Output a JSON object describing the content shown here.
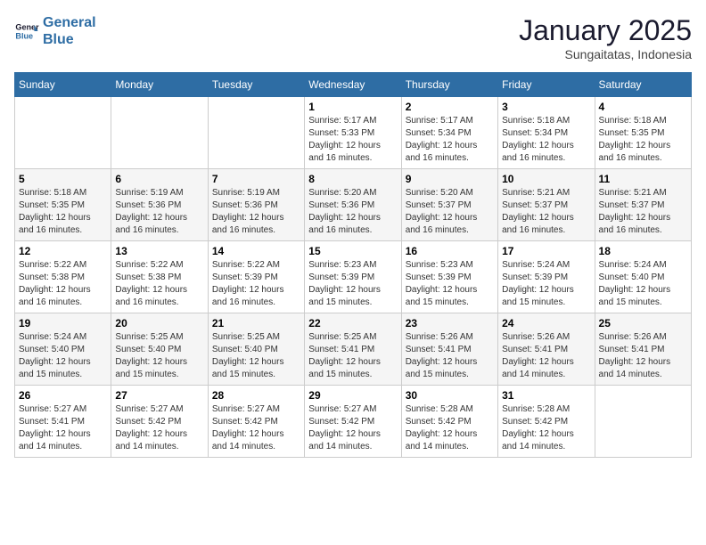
{
  "logo": {
    "line1": "General",
    "line2": "Blue"
  },
  "title": {
    "month_year": "January 2025",
    "location": "Sungaitatas, Indonesia"
  },
  "weekdays": [
    "Sunday",
    "Monday",
    "Tuesday",
    "Wednesday",
    "Thursday",
    "Friday",
    "Saturday"
  ],
  "weeks": [
    [
      {
        "day": "",
        "info": ""
      },
      {
        "day": "",
        "info": ""
      },
      {
        "day": "",
        "info": ""
      },
      {
        "day": "1",
        "info": "Sunrise: 5:17 AM\nSunset: 5:33 PM\nDaylight: 12 hours\nand 16 minutes."
      },
      {
        "day": "2",
        "info": "Sunrise: 5:17 AM\nSunset: 5:34 PM\nDaylight: 12 hours\nand 16 minutes."
      },
      {
        "day": "3",
        "info": "Sunrise: 5:18 AM\nSunset: 5:34 PM\nDaylight: 12 hours\nand 16 minutes."
      },
      {
        "day": "4",
        "info": "Sunrise: 5:18 AM\nSunset: 5:35 PM\nDaylight: 12 hours\nand 16 minutes."
      }
    ],
    [
      {
        "day": "5",
        "info": "Sunrise: 5:18 AM\nSunset: 5:35 PM\nDaylight: 12 hours\nand 16 minutes."
      },
      {
        "day": "6",
        "info": "Sunrise: 5:19 AM\nSunset: 5:36 PM\nDaylight: 12 hours\nand 16 minutes."
      },
      {
        "day": "7",
        "info": "Sunrise: 5:19 AM\nSunset: 5:36 PM\nDaylight: 12 hours\nand 16 minutes."
      },
      {
        "day": "8",
        "info": "Sunrise: 5:20 AM\nSunset: 5:36 PM\nDaylight: 12 hours\nand 16 minutes."
      },
      {
        "day": "9",
        "info": "Sunrise: 5:20 AM\nSunset: 5:37 PM\nDaylight: 12 hours\nand 16 minutes."
      },
      {
        "day": "10",
        "info": "Sunrise: 5:21 AM\nSunset: 5:37 PM\nDaylight: 12 hours\nand 16 minutes."
      },
      {
        "day": "11",
        "info": "Sunrise: 5:21 AM\nSunset: 5:37 PM\nDaylight: 12 hours\nand 16 minutes."
      }
    ],
    [
      {
        "day": "12",
        "info": "Sunrise: 5:22 AM\nSunset: 5:38 PM\nDaylight: 12 hours\nand 16 minutes."
      },
      {
        "day": "13",
        "info": "Sunrise: 5:22 AM\nSunset: 5:38 PM\nDaylight: 12 hours\nand 16 minutes."
      },
      {
        "day": "14",
        "info": "Sunrise: 5:22 AM\nSunset: 5:39 PM\nDaylight: 12 hours\nand 16 minutes."
      },
      {
        "day": "15",
        "info": "Sunrise: 5:23 AM\nSunset: 5:39 PM\nDaylight: 12 hours\nand 15 minutes."
      },
      {
        "day": "16",
        "info": "Sunrise: 5:23 AM\nSunset: 5:39 PM\nDaylight: 12 hours\nand 15 minutes."
      },
      {
        "day": "17",
        "info": "Sunrise: 5:24 AM\nSunset: 5:39 PM\nDaylight: 12 hours\nand 15 minutes."
      },
      {
        "day": "18",
        "info": "Sunrise: 5:24 AM\nSunset: 5:40 PM\nDaylight: 12 hours\nand 15 minutes."
      }
    ],
    [
      {
        "day": "19",
        "info": "Sunrise: 5:24 AM\nSunset: 5:40 PM\nDaylight: 12 hours\nand 15 minutes."
      },
      {
        "day": "20",
        "info": "Sunrise: 5:25 AM\nSunset: 5:40 PM\nDaylight: 12 hours\nand 15 minutes."
      },
      {
        "day": "21",
        "info": "Sunrise: 5:25 AM\nSunset: 5:40 PM\nDaylight: 12 hours\nand 15 minutes."
      },
      {
        "day": "22",
        "info": "Sunrise: 5:25 AM\nSunset: 5:41 PM\nDaylight: 12 hours\nand 15 minutes."
      },
      {
        "day": "23",
        "info": "Sunrise: 5:26 AM\nSunset: 5:41 PM\nDaylight: 12 hours\nand 15 minutes."
      },
      {
        "day": "24",
        "info": "Sunrise: 5:26 AM\nSunset: 5:41 PM\nDaylight: 12 hours\nand 14 minutes."
      },
      {
        "day": "25",
        "info": "Sunrise: 5:26 AM\nSunset: 5:41 PM\nDaylight: 12 hours\nand 14 minutes."
      }
    ],
    [
      {
        "day": "26",
        "info": "Sunrise: 5:27 AM\nSunset: 5:41 PM\nDaylight: 12 hours\nand 14 minutes."
      },
      {
        "day": "27",
        "info": "Sunrise: 5:27 AM\nSunset: 5:42 PM\nDaylight: 12 hours\nand 14 minutes."
      },
      {
        "day": "28",
        "info": "Sunrise: 5:27 AM\nSunset: 5:42 PM\nDaylight: 12 hours\nand 14 minutes."
      },
      {
        "day": "29",
        "info": "Sunrise: 5:27 AM\nSunset: 5:42 PM\nDaylight: 12 hours\nand 14 minutes."
      },
      {
        "day": "30",
        "info": "Sunrise: 5:28 AM\nSunset: 5:42 PM\nDaylight: 12 hours\nand 14 minutes."
      },
      {
        "day": "31",
        "info": "Sunrise: 5:28 AM\nSunset: 5:42 PM\nDaylight: 12 hours\nand 14 minutes."
      },
      {
        "day": "",
        "info": ""
      }
    ]
  ]
}
